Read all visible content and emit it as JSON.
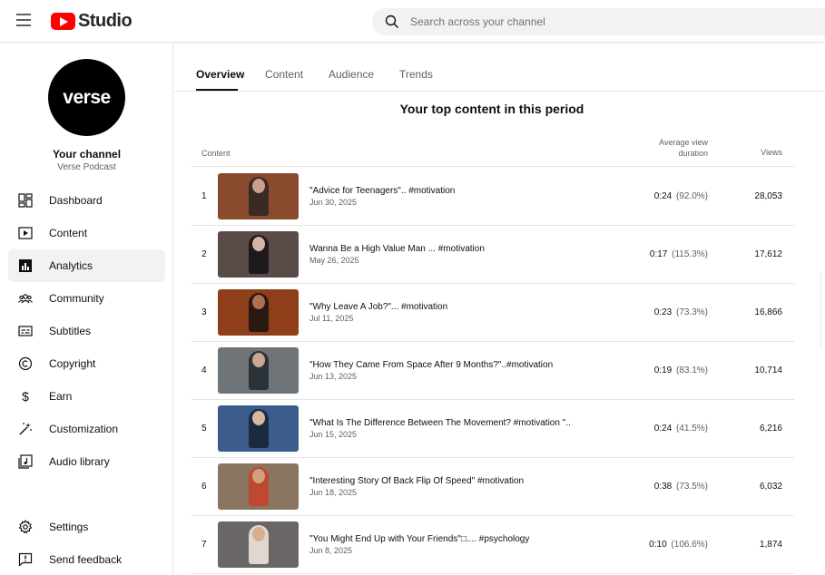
{
  "app": {
    "logo_text": "Studio",
    "search_placeholder": "Search across your channel"
  },
  "channel": {
    "avatar_text": "verse",
    "name": "Your channel",
    "subtitle": "Verse Podcast"
  },
  "sidebar": {
    "items": [
      {
        "label": "Dashboard",
        "icon": "dashboard-icon",
        "active": false
      },
      {
        "label": "Content",
        "icon": "content-icon",
        "active": false
      },
      {
        "label": "Analytics",
        "icon": "analytics-icon",
        "active": true
      },
      {
        "label": "Community",
        "icon": "community-icon",
        "active": false
      },
      {
        "label": "Subtitles",
        "icon": "subtitles-icon",
        "active": false
      },
      {
        "label": "Copyright",
        "icon": "copyright-icon",
        "active": false
      },
      {
        "label": "Earn",
        "icon": "earn-icon",
        "active": false
      },
      {
        "label": "Customization",
        "icon": "customization-icon",
        "active": false
      },
      {
        "label": "Audio library",
        "icon": "audio-library-icon",
        "active": false
      }
    ],
    "bottom_items": [
      {
        "label": "Settings",
        "icon": "settings-icon"
      },
      {
        "label": "Send feedback",
        "icon": "feedback-icon"
      }
    ]
  },
  "tabs": [
    {
      "label": "Overview",
      "active": true
    },
    {
      "label": "Content",
      "active": false
    },
    {
      "label": "Audience",
      "active": false
    },
    {
      "label": "Trends",
      "active": false
    }
  ],
  "section_title": "Your top content in this period",
  "table": {
    "columns": {
      "content": "Content",
      "avd_line1": "Average view",
      "avd_line2": "duration",
      "views": "Views"
    },
    "rows": [
      {
        "rank": "1",
        "title": "\"Advice for Teenagers\".. #motivation",
        "date": "Jun 30, 2025",
        "avd": "0:24",
        "pct": "(92.0%)",
        "views": "28,053",
        "bg": "#8a4a2e",
        "person": "#3a2a24",
        "face": "#c8a08a"
      },
      {
        "rank": "2",
        "title": "Wanna Be a High Value Man ... #motivation",
        "date": "May 26, 2025",
        "avd": "0:17",
        "pct": "(115.3%)",
        "views": "17,612",
        "bg": "#5a4a48",
        "person": "#1e1a1c",
        "face": "#d6b4a4"
      },
      {
        "rank": "3",
        "title": "\"Why Leave A Job?\"... #motivation",
        "date": "Jul 11, 2025",
        "avd": "0:23",
        "pct": "(73.3%)",
        "views": "16,866",
        "bg": "#8f3e1a",
        "person": "#2a1812",
        "face": "#b07050"
      },
      {
        "rank": "4",
        "title": "\"How They Came From Space After 9 Months?\"..#motivation",
        "date": "Jun 13, 2025",
        "avd": "0:19",
        "pct": "(83.1%)",
        "views": "10,714",
        "bg": "#6e7478",
        "person": "#2c3338",
        "face": "#caa890"
      },
      {
        "rank": "5",
        "title": "\"What Is The Difference Between The Movement? #motivation \"..",
        "date": "Jun 15, 2025",
        "avd": "0:24",
        "pct": "(41.5%)",
        "views": "6,216",
        "bg": "#3c5c8c",
        "person": "#1c2a40",
        "face": "#d8b8a0"
      },
      {
        "rank": "6",
        "title": "\"Interesting Story Of Back Flip Of Speed\" #motivation",
        "date": "Jun 18, 2025",
        "avd": "0:38",
        "pct": "(73.5%)",
        "views": "6,032",
        "bg": "#8a7660",
        "person": "#c04830",
        "face": "#d0a080"
      },
      {
        "rank": "7",
        "title": "\"You Might End Up with Your Friends\"□.... #psychology",
        "date": "Jun 8, 2025",
        "avd": "0:10",
        "pct": "(106.6%)",
        "views": "1,874",
        "bg": "#6a6666",
        "person": "#e0d8d0",
        "face": "#d8b090"
      }
    ]
  },
  "colors": {
    "brand_red": "#ff0000",
    "text_primary": "#0f0f0f",
    "text_secondary": "#606060"
  }
}
